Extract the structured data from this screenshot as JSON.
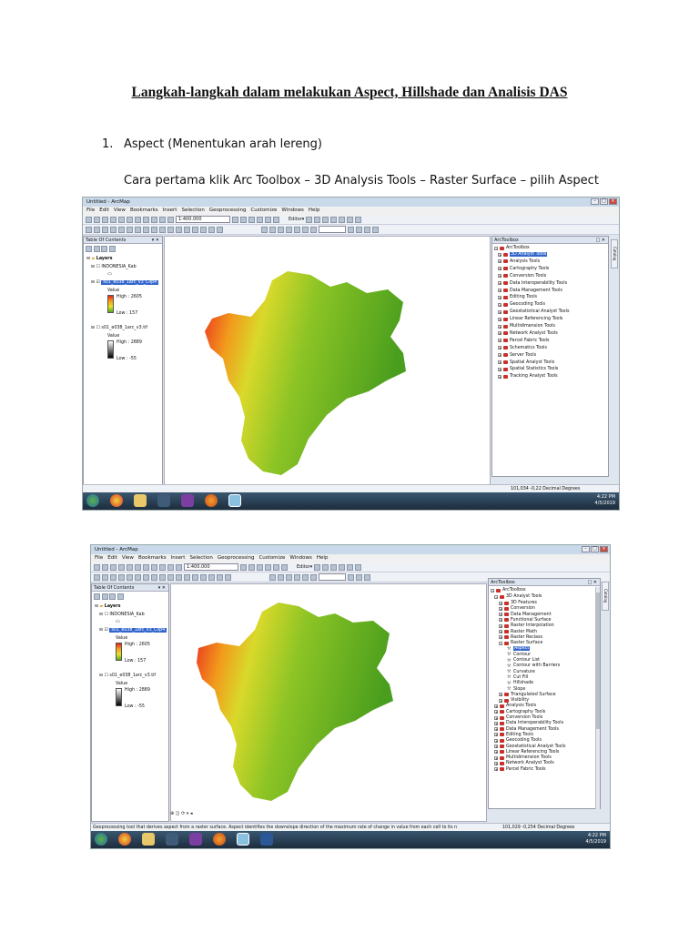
{
  "document": {
    "title": "Langkah-langkah dalam melakukan Aspect, Hillshade dan Analisis DAS",
    "step_number": "1.",
    "step_title": "Aspect (Menentukan arah lereng)",
    "instruction": "Cara pertama klik Arc Toolbox – 3D Analysis Tools – Raster Surface – pilih Aspect"
  },
  "screenshot1": {
    "window_title": "Untitled - ArcMap",
    "menu": [
      "File",
      "Edit",
      "View",
      "Bookmarks",
      "Insert",
      "Selection",
      "Geoprocessing",
      "Customize",
      "Windows",
      "Help"
    ],
    "scale": "1:400.000",
    "editor_label": "Editor▾",
    "toc": {
      "title": "Table Of Contents",
      "layers_label": "Layers",
      "layer1": "INDONESIA_Kab",
      "layer2": "s01_e038_1arc_v3_Clip4",
      "layer2_value_label": "Value",
      "layer2_high": "High : 2605",
      "layer2_low": "Low : 157",
      "layer3": "s01_e038_1arc_v3.tif",
      "layer3_value_label": "Value",
      "layer3_high": "High : 2889",
      "layer3_low": "Low : -55"
    },
    "toolbox": {
      "title": "ArcToolbox",
      "root": "ArcToolbox",
      "items": [
        "3D Analyst Tools",
        "Analysis Tools",
        "Cartography Tools",
        "Conversion Tools",
        "Data Interoperability Tools",
        "Data Management Tools",
        "Editing Tools",
        "Geocoding Tools",
        "Geostatistical Analyst Tools",
        "Linear Referencing Tools",
        "Multidimension Tools",
        "Network Analyst Tools",
        "Parcel Fabric Tools",
        "Schematics Tools",
        "Server Tools",
        "Spatial Analyst Tools",
        "Spatial Statistics Tools",
        "Tracking Analyst Tools"
      ]
    },
    "side_tab": "Catalog",
    "status_coords": "101,034 -0,22 Decimal Degrees",
    "clock_time": "4:22 PM",
    "clock_date": "4/5/2019"
  },
  "screenshot2": {
    "window_title": "Untitled - ArcMap",
    "menu": [
      "File",
      "Edit",
      "View",
      "Bookmarks",
      "Insert",
      "Selection",
      "Geoprocessing",
      "Customize",
      "Windows",
      "Help"
    ],
    "scale": "1:400.000",
    "editor_label": "Editor▾",
    "toc": {
      "title": "Table Of Contents",
      "layers_label": "Layers",
      "layer1": "INDONESIA_Kab",
      "layer2": "s01_e038_1arc_v3_Clip4",
      "layer2_value_label": "Value",
      "layer2_high": "High : 2605",
      "layer2_low": "Low : 157",
      "layer3": "s01_e038_1arc_v3.tif",
      "layer3_value_label": "Value",
      "layer3_high": "High : 2889",
      "layer3_low": "Low : -55"
    },
    "toolbox": {
      "title": "ArcToolbox",
      "root": "ArcToolbox",
      "analyst": "3D Analyst Tools",
      "analyst_children": [
        "3D Features",
        "Conversion",
        "Data Management",
        "Functional Surface",
        "Raster Interpolation",
        "Raster Math",
        "Raster Reclass",
        "Raster Surface"
      ],
      "surface_children": [
        "Aspect",
        "Contour",
        "Contour List",
        "Contour with Barriers",
        "Curvature",
        "Cut Fill",
        "Hillshade",
        "Slope"
      ],
      "after": [
        "Triangulated Surface",
        "Visibility"
      ],
      "others": [
        "Analysis Tools",
        "Cartography Tools",
        "Conversion Tools",
        "Data Interoperability Tools",
        "Data Management Tools",
        "Editing Tools",
        "Geocoding Tools",
        "Geostatistical Analyst Tools",
        "Linear Referencing Tools",
        "Multidimension Tools",
        "Network Analyst Tools",
        "Parcel Fabric Tools"
      ]
    },
    "side_tab": "Catalog",
    "status_message": "Geoprocessing tool that derives aspect from a raster surface. Aspect identifies the downslope direction of the maximum rate of change in value from each cell to its neighbors.",
    "status_coords": "101,029 -0,254 Decimal Degrees",
    "clock_time": "4:22 PM",
    "clock_date": "4/5/2019"
  },
  "colors": {
    "high": "#e81f1f",
    "mid": "#e6e32a",
    "low": "#52a81e",
    "selection": "#3366cc"
  }
}
